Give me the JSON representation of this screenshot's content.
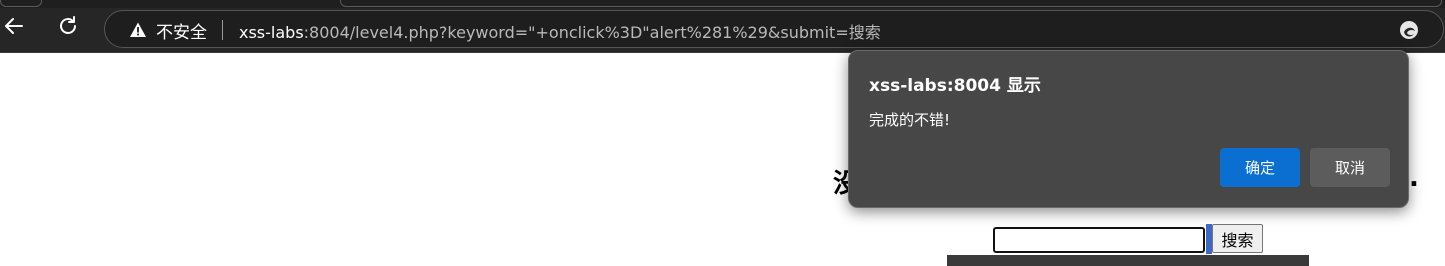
{
  "browser": {
    "security_label": "不安全",
    "url_host": "xss-labs",
    "url_rest": ":8004/level4.php?keyword=\"+onclick%3D\"alert%281%29&submit=搜索",
    "icons": {
      "back": "back-arrow-icon",
      "reload": "reload-icon",
      "warning": "warning-icon",
      "extension": "extension-icon"
    }
  },
  "page": {
    "heading_partial": "没",
    "heading_tail": ".",
    "search_input_value": "",
    "search_button_label": "搜索"
  },
  "dialog": {
    "title": "xss-labs:8004 显示",
    "message": "完成的不错!",
    "ok_label": "确定",
    "cancel_label": "取消"
  },
  "colors": {
    "toolbar_bg": "#262626",
    "dialog_bg": "#474747",
    "ok_button": "#0a6fd0",
    "cancel_button": "#5c5c5c",
    "focus_accent": "#3f67c6"
  }
}
